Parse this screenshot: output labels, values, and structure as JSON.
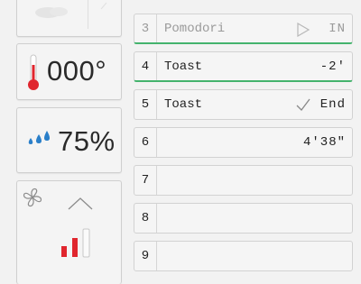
{
  "left_panel": {
    "weather_icon": "cloud-icon",
    "temperature": {
      "icon": "thermometer-icon",
      "value": "000°"
    },
    "humidity": {
      "icon": "water-drops-icon",
      "value": "75%"
    },
    "fan": {
      "icon": "fan-icon",
      "chevron": "chevron-up-icon",
      "level_icon": "signal-bars-icon",
      "level_filled": 2,
      "level_total": 3
    }
  },
  "colors": {
    "accent_green": "#44b36d",
    "thermo_red": "#e0262e",
    "drop_blue": "#2a7fc9"
  },
  "program_steps": [
    {
      "num": "3",
      "name": "Pomodori",
      "status_icon": "play-icon",
      "value": "IN"
    },
    {
      "num": "4",
      "name": "Toast",
      "status_icon": "",
      "value": "-2'"
    },
    {
      "num": "5",
      "name": "Toast",
      "status_icon": "check-icon",
      "value": "End"
    },
    {
      "num": "6",
      "name": "",
      "status_icon": "",
      "value": "4'38\""
    },
    {
      "num": "7",
      "name": "",
      "status_icon": "",
      "value": ""
    },
    {
      "num": "8",
      "name": "",
      "status_icon": "",
      "value": ""
    },
    {
      "num": "9",
      "name": "",
      "status_icon": "",
      "value": ""
    }
  ]
}
